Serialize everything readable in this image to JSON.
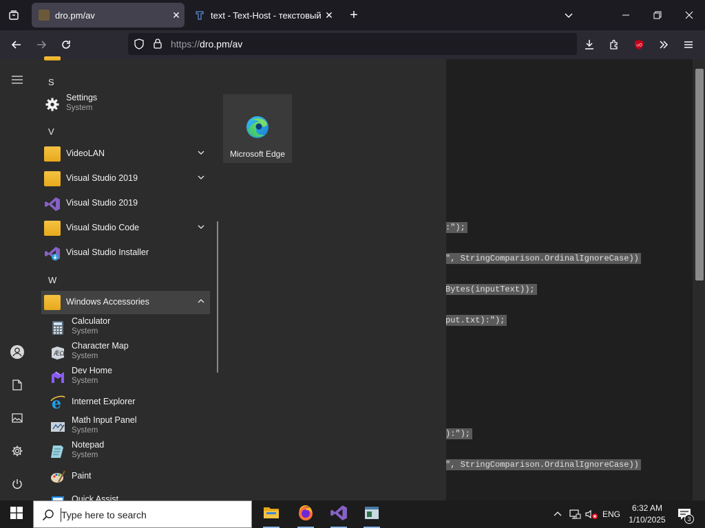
{
  "browser": {
    "tabs": [
      {
        "title": "dro.pm/av",
        "active": true
      },
      {
        "title": "text - Text-Host - текстовый хо",
        "active": false
      }
    ],
    "url_scheme": "https://",
    "url_rest": "dro.pm/av"
  },
  "page_code": [
    ":\");",
    "\", StringComparison.OrdinalIgnoreCase))",
    "Bytes(inputText));",
    "put.txt):\");",
    "):\");",
    "\", StringComparison.OrdinalIgnoreCase))"
  ],
  "start_menu": {
    "letters": {
      "s": "S",
      "v": "V",
      "w": "W"
    },
    "apps": {
      "settings": {
        "name": "Settings",
        "desc": "System"
      },
      "videolan": {
        "name": "VideoLAN"
      },
      "vs2019_folder": {
        "name": "Visual Studio 2019"
      },
      "vs2019": {
        "name": "Visual Studio 2019"
      },
      "vscode": {
        "name": "Visual Studio Code"
      },
      "vs_installer": {
        "name": "Visual Studio Installer"
      },
      "win_accessories": {
        "name": "Windows Accessories"
      }
    },
    "accessories": [
      {
        "name": "Calculator",
        "desc": "System"
      },
      {
        "name": "Character Map",
        "desc": "System"
      },
      {
        "name": "Dev Home",
        "desc": "System"
      },
      {
        "name": "Internet Explorer",
        "desc": ""
      },
      {
        "name": "Math Input Panel",
        "desc": "System"
      },
      {
        "name": "Notepad",
        "desc": "System"
      },
      {
        "name": "Paint",
        "desc": ""
      },
      {
        "name": "Quick Assist",
        "desc": ""
      }
    ],
    "pinned_tile": {
      "name": "Microsoft Edge"
    }
  },
  "taskbar": {
    "search_placeholder": "Type here to search",
    "lang": "ENG",
    "time": "6:32 AM",
    "date": "1/10/2025",
    "notifications": "3"
  },
  "colors": {
    "accent": "#0078d4",
    "selection": "#5a5a5a"
  }
}
